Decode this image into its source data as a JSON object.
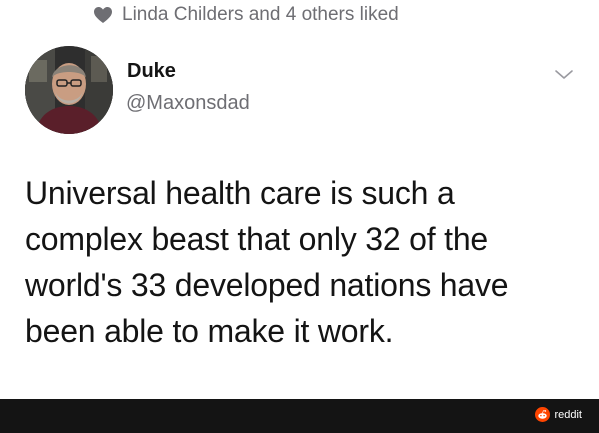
{
  "liked": {
    "icon": "heart-icon",
    "text": "Linda Childers and 4 others liked"
  },
  "tweet": {
    "author_name": "Duke",
    "handle": "@Maxonsdad",
    "text": "Universal health care is such a\ncomplex beast that only 32 of the\nworld's 33 developed nations have\nbeen able to make it work.",
    "menu_icon": "chevron-down-icon"
  },
  "watermark": {
    "icon": "reddit-icon",
    "label": "reddit",
    "accent": "#ff4500"
  },
  "colors": {
    "text": "#141414",
    "secondary_text": "#6e6e73",
    "footer": "#141414"
  }
}
